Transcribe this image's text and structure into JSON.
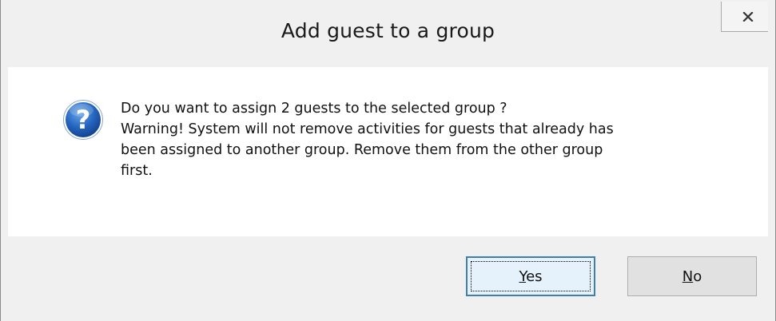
{
  "dialog": {
    "title": "Add guest to a group",
    "close_label": "x",
    "icon": "question-icon",
    "message_lines": [
      "Do you want to assign 2 guests to the selected group ?",
      "Warning! System will not remove activities for guests that already has",
      "been assigned to another group. Remove them from the other group",
      "first."
    ],
    "buttons": {
      "yes": {
        "accel": "Y",
        "rest": "es"
      },
      "no": {
        "accel": "N",
        "rest": "o"
      }
    },
    "colors": {
      "icon_blue": "#1f5fb0",
      "focus_border": "#3c7fb1"
    }
  }
}
